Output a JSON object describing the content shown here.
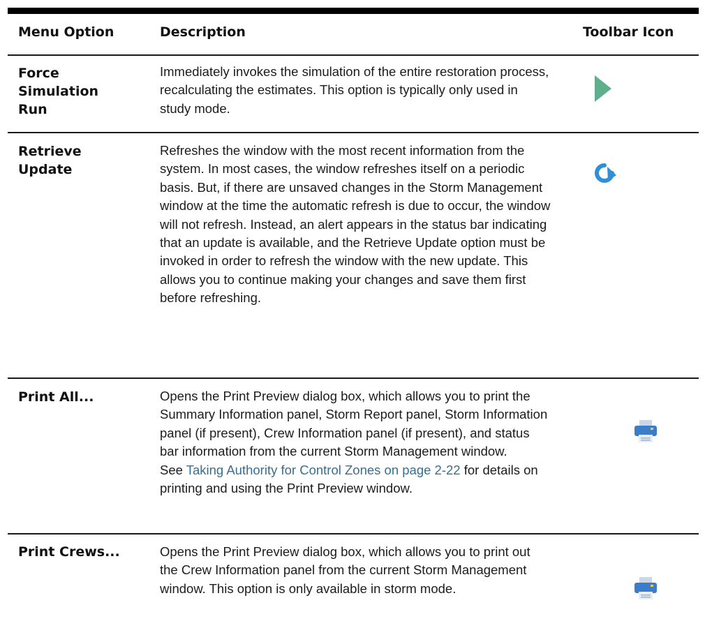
{
  "table": {
    "headers": {
      "menu_option": "Menu Option",
      "description": "Description",
      "toolbar_icon": "Toolbar Icon"
    },
    "rows": [
      {
        "option": "Force Simulation Run",
        "description": "Immediately invokes the simulation of the entire restoration process, recalculating the estimates. This option is typically only used in study mode.",
        "icon": "play-triangle-icon"
      },
      {
        "option": "Retrieve Update",
        "description": "Refreshes the window with the most recent information from the system. In most cases, the window refreshes itself on a periodic basis. But, if there are unsaved changes in the Storm Management window at the time the automatic refresh is due to occur, the window will not refresh. Instead, an alert appears in the status bar indicating that an update is available, and the Retrieve Update option must be invoked in order to refresh the window with the new update. This allows you to continue making your changes and save them first before refreshing.",
        "icon": "refresh-icon"
      },
      {
        "option": "Print All...",
        "description": "Opens the Print Preview dialog box, which allows you to print the Summary Information panel, Storm Report panel, Storm Information panel (if present), Crew Information panel (if present), and status bar information from the current Storm Management window.",
        "see_prefix": "See ",
        "link_text": "Taking Authority for Control Zones on page 2-22",
        "see_suffix": " for details on printing and using the Print Preview window.",
        "icon": "printer-icon"
      },
      {
        "option": "Print Crews...",
        "description": "Opens the Print Preview dialog box, which allows you to print out the Crew Information panel from the current Storm Management window. This option is only available in storm mode.",
        "icon": "printer-icon"
      }
    ]
  },
  "colors": {
    "play_icon": "#5fae8c",
    "refresh_icon": "#2f8fd8",
    "printer_icon": "#3d7cc9",
    "link": "#3a6f8c"
  }
}
